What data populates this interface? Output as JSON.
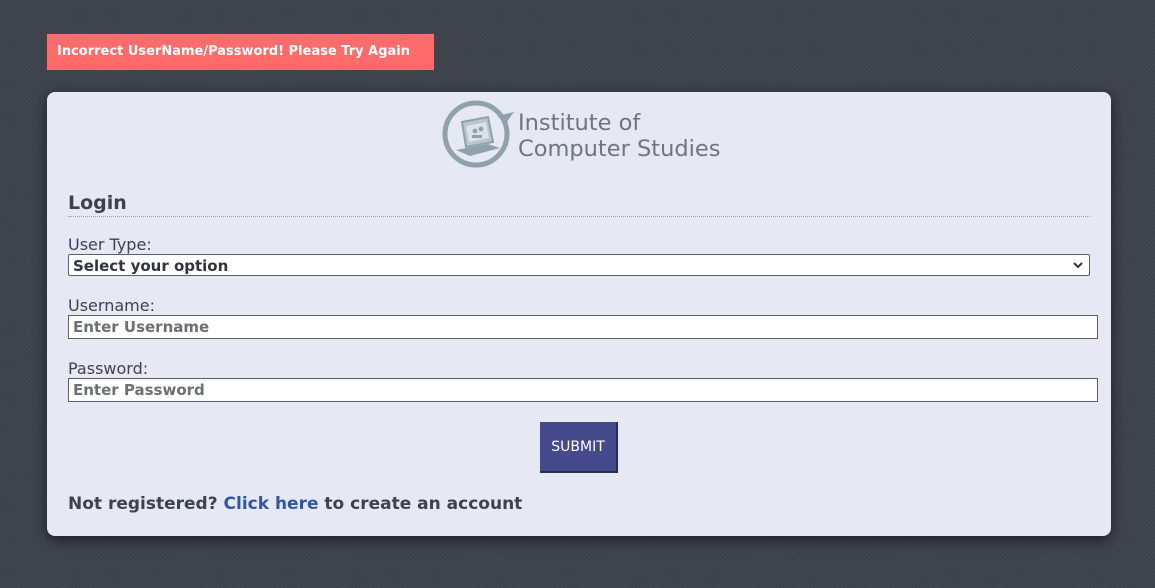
{
  "alert": {
    "message": "Incorrect UserName/Password! Please Try Again",
    "color": "#ff6b6b"
  },
  "logo": {
    "line1": "Institute of",
    "line2": "Computer Studies"
  },
  "login": {
    "heading": "Login",
    "user_type": {
      "label": "User Type:",
      "selected": "Select your option"
    },
    "username": {
      "label": "Username:",
      "placeholder": "Enter Username",
      "value": ""
    },
    "password": {
      "label": "Password:",
      "placeholder": "Enter Password",
      "value": ""
    },
    "submit_label": "SUBMIT"
  },
  "register": {
    "prefix": "Not registered?",
    "link_text": "Click here",
    "suffix": "to create an account"
  },
  "colors": {
    "background": "#3f444d",
    "card": "#e6e8f4",
    "submit": "#454a8c",
    "link": "#2f56a6"
  },
  "icons": [
    "logo-emblem-icon",
    "chevron-down-icon"
  ]
}
